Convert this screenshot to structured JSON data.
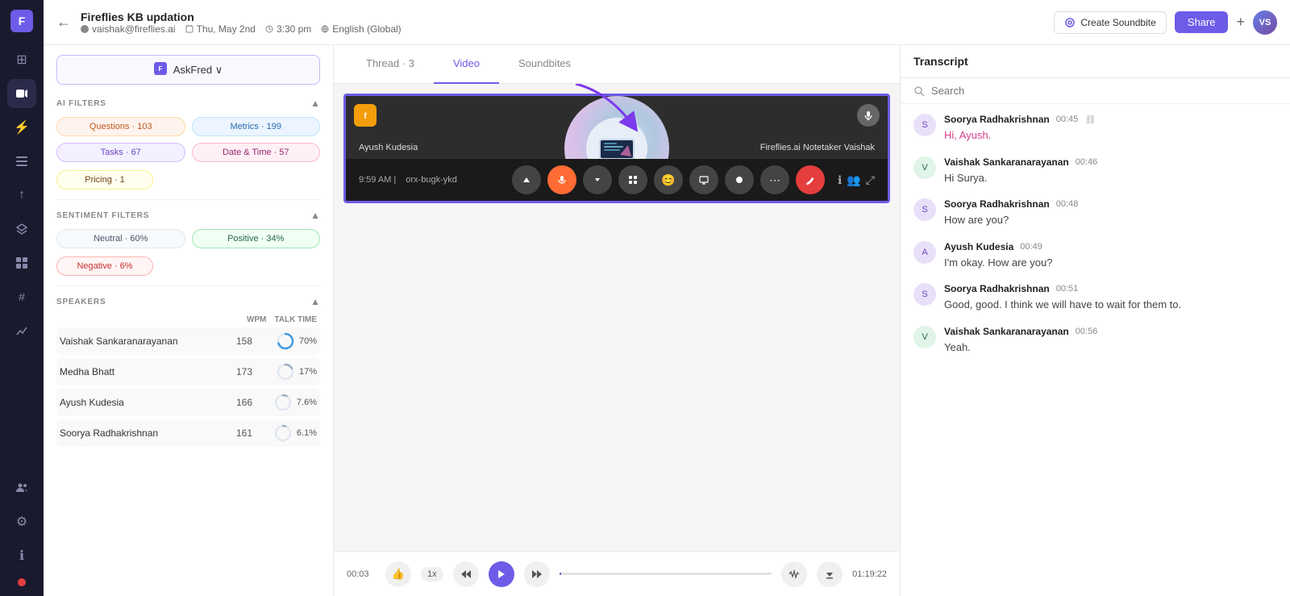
{
  "app": {
    "title": "Fireflies KB updation",
    "user_email": "vaishak@fireflies.ai",
    "date": "Thu, May 2nd",
    "time": "3:30 pm",
    "language": "English (Global)"
  },
  "header": {
    "back_label": "←",
    "create_soundbite_label": "Create Soundbite",
    "share_label": "Share",
    "plus_label": "+",
    "avatar_initials": "VS"
  },
  "tabs": {
    "thread_label": "Thread · 3",
    "video_label": "Video",
    "soundbites_label": "Soundbites"
  },
  "sidebar": {
    "ask_fred_label": "AskFred ∨",
    "ai_filters_title": "AI FILTERS",
    "filters": [
      {
        "label": "Questions · 103",
        "style": "orange"
      },
      {
        "label": "Metrics · 199",
        "style": "blue"
      },
      {
        "label": "Tasks · 67",
        "style": "purple"
      },
      {
        "label": "Date & Time · 57",
        "style": "pink"
      },
      {
        "label": "Pricing · 1",
        "style": "yellow"
      }
    ],
    "sentiment_filters_title": "SENTIMENT FILTERS",
    "sentiment_filters": [
      {
        "label": "Neutral · 60%",
        "style": "neutral"
      },
      {
        "label": "Positive · 34%",
        "style": "positive"
      },
      {
        "label": "Negative · 6%",
        "style": "negative"
      }
    ],
    "speakers_title": "SPEAKERS",
    "speakers_col_wpm": "WPM",
    "speakers_col_talk": "TALK TIME",
    "speakers": [
      {
        "name": "Vaishak Sankaranarayanan",
        "wpm": "158",
        "talk_pct": "70%",
        "progress": 70,
        "color": "#4299e1"
      },
      {
        "name": "Medha Bhatt",
        "wpm": "173",
        "talk_pct": "17%",
        "progress": 17,
        "color": "#a0aec0"
      },
      {
        "name": "Ayush Kudesia",
        "wpm": "166",
        "talk_pct": "7.6%",
        "progress": 8,
        "color": "#a0aec0"
      },
      {
        "name": "Soorya Radhakrishnan",
        "wpm": "161",
        "talk_pct": "6.1%",
        "progress": 6,
        "color": "#a0aec0"
      }
    ]
  },
  "video": {
    "call_time": "9:59 AM",
    "call_id": "orx-bugk-ykd",
    "bottom_left_label": "Ayush Kudesia",
    "bottom_right_label": "Fireflies.ai Notetaker Vaishak"
  },
  "player": {
    "current_time": "00:03",
    "total_time": "01:19:22",
    "speed": "1x",
    "like_icon": "👍",
    "rewind_icon": "↺",
    "forward_icon": "↻",
    "bars_icon": "≋",
    "download_icon": "⬇"
  },
  "transcript": {
    "title": "Transcript",
    "search_placeholder": "Search",
    "messages": [
      {
        "name": "Soorya Radhakrishnan",
        "time": "00:45",
        "text": "Hi, Ayush.",
        "highlight": true,
        "avatar_style": "purple"
      },
      {
        "name": "Vaishak Sankaranarayanan",
        "time": "00:46",
        "text": "Hi Surya.",
        "highlight": false,
        "avatar_style": "green"
      },
      {
        "name": "Soorya Radhakrishnan",
        "time": "00:48",
        "text": "How are you?",
        "highlight": false,
        "avatar_style": "purple"
      },
      {
        "name": "Ayush Kudesia",
        "time": "00:49",
        "text": "I'm okay. How are you?",
        "highlight": false,
        "avatar_style": "purple"
      },
      {
        "name": "Soorya Radhakrishnan",
        "time": "00:51",
        "text": "Good, good. I think we will have to wait for them to.",
        "highlight": false,
        "avatar_style": "purple"
      },
      {
        "name": "Vaishak Sankaranarayanan",
        "time": "00:56",
        "text": "Yeah.",
        "highlight": false,
        "avatar_style": "green"
      }
    ]
  },
  "nav": {
    "icons": [
      {
        "name": "home-icon",
        "symbol": "⊞",
        "active": false
      },
      {
        "name": "video-icon",
        "symbol": "▶",
        "active": true
      },
      {
        "name": "lightning-icon",
        "symbol": "⚡",
        "active": false
      },
      {
        "name": "list-icon",
        "symbol": "≡",
        "active": false
      },
      {
        "name": "upload-icon",
        "symbol": "↑",
        "active": false
      },
      {
        "name": "layers-icon",
        "symbol": "◫",
        "active": false
      },
      {
        "name": "grid-icon",
        "symbol": "⊞",
        "active": false
      },
      {
        "name": "hash-icon",
        "symbol": "#",
        "active": false
      },
      {
        "name": "chart-icon",
        "symbol": "↗",
        "active": false
      },
      {
        "name": "users-icon",
        "symbol": "👤",
        "active": false
      },
      {
        "name": "settings-icon",
        "symbol": "⚙",
        "active": false
      },
      {
        "name": "info-icon",
        "symbol": "ℹ",
        "active": false
      }
    ]
  }
}
